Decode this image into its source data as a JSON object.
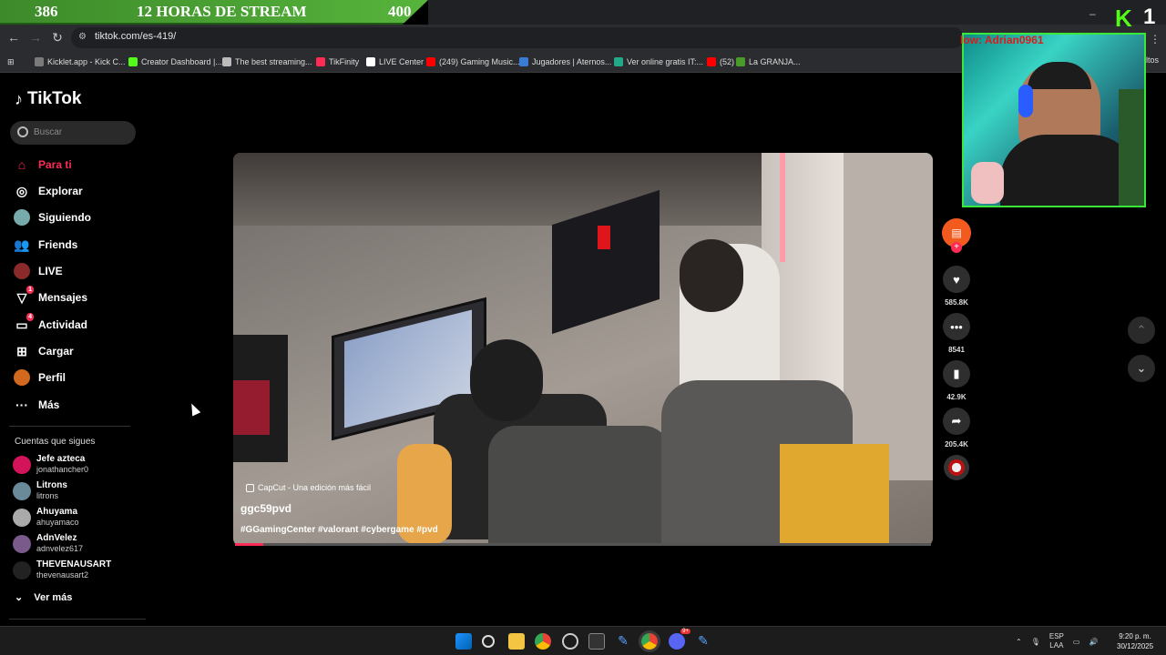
{
  "stream_overlay": {
    "left_number": "386",
    "title": "12 HORAS DE STREAM",
    "right_number": "400"
  },
  "webcam": {
    "label": "low: Adrian0961"
  },
  "kick": {
    "logo": "K",
    "count": "1"
  },
  "browser": {
    "url": "tiktok.com/es-419/",
    "bookmarks": [
      {
        "label": "Kicklet.app - Kick C...",
        "color": "#7a7a7a"
      },
      {
        "label": "Creator Dashboard |...",
        "color": "#53fc18"
      },
      {
        "label": "The best streaming...",
        "color": "#bbbbbb"
      },
      {
        "label": "TikFinity",
        "color": "#fe2c55"
      },
      {
        "label": "LIVE Center",
        "color": "#ffffff"
      },
      {
        "label": "(249) Gaming Music...",
        "color": "#ff0000"
      },
      {
        "label": "Jugadores | Aternos...",
        "color": "#3a7bd5"
      },
      {
        "label": "Ver online gratis IT:...",
        "color": "#22aa88"
      },
      {
        "label": "(52)",
        "color": "#ff0000"
      },
      {
        "label": "La GRANJA...",
        "color": "#4a9a2a"
      }
    ],
    "bookmarks_right": "ltos"
  },
  "sidebar": {
    "logo": "TikTok",
    "search_placeholder": "Buscar",
    "nav": [
      {
        "label": "Para ti",
        "icon": "home-icon",
        "active": true
      },
      {
        "label": "Explorar",
        "icon": "compass-icon"
      },
      {
        "label": "Siguiendo",
        "icon": "following-avatar"
      },
      {
        "label": "Friends",
        "icon": "friends-icon"
      },
      {
        "label": "LIVE",
        "icon": "live-avatar"
      },
      {
        "label": "Mensajes",
        "icon": "messages-icon",
        "badge": "1"
      },
      {
        "label": "Actividad",
        "icon": "activity-icon",
        "badge": "4"
      },
      {
        "label": "Cargar",
        "icon": "upload-icon"
      },
      {
        "label": "Perfil",
        "icon": "profile-avatar"
      },
      {
        "label": "Más",
        "icon": "more-icon"
      }
    ],
    "following_title": "Cuentas que sigues",
    "accounts": [
      {
        "name": "Jefe azteca",
        "user": "jonathancher0",
        "color": "#d4145a"
      },
      {
        "name": "Litrons",
        "user": "litrons",
        "color": "#6a8a9a"
      },
      {
        "name": "Ahuyama",
        "user": "ahuyamaco",
        "color": "#aaaaaa"
      },
      {
        "name": "AdnVelez",
        "user": "adnvelez617",
        "color": "#7a5a8a"
      },
      {
        "name": "THEVENAUSART",
        "user": "thevenausart2",
        "color": "#222222"
      }
    ],
    "see_more": "Ver más"
  },
  "video": {
    "watermark": "CapCut - Una edición más fácil",
    "author": "ggc59pvd",
    "tags": "#GGamingCenter #valorant #cybergame #pvd",
    "progress": 0.04
  },
  "actions": {
    "likes": "585.8K",
    "comments": "8541",
    "saves": "42.9K",
    "shares": "205.4K"
  },
  "taskbar": {
    "lang_top": "ESP",
    "lang_bottom": "LAA",
    "time": "9:20 p. m.",
    "date": "30/12/2025",
    "discord_badge": "9+"
  }
}
